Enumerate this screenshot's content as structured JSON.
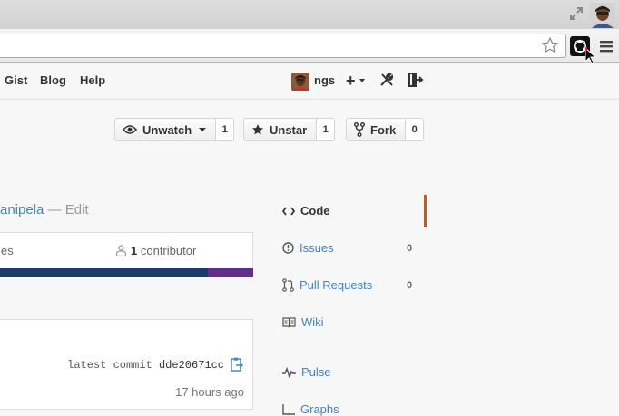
{
  "header": {
    "nav": [
      "Gist",
      "Blog",
      "Help"
    ],
    "username": "ngs",
    "plus_label": "+"
  },
  "repo_actions": {
    "watch": {
      "label": "Unwatch",
      "count": "1"
    },
    "star": {
      "label": "Unstar",
      "count": "1"
    },
    "fork": {
      "label": "Fork",
      "count": "0"
    }
  },
  "title": {
    "name": "anipela",
    "separator": "—",
    "edit": "Edit"
  },
  "stats": {
    "branches_partial": "es",
    "contributors_count": "1",
    "contributors_label": "contributor"
  },
  "language_colors": [
    "#1c3b6b",
    "#5f2f8a"
  ],
  "commit": {
    "label": "latest commit",
    "hash": "dde20671cc",
    "time": "17 hours ago"
  },
  "repo_nav": [
    {
      "label": "Code",
      "icon": "code-icon",
      "selected": true
    },
    {
      "label": "Issues",
      "icon": "issue-icon",
      "count": "0"
    },
    {
      "label": "Pull Requests",
      "icon": "pull-request-icon",
      "count": "0"
    },
    {
      "label": "Wiki",
      "icon": "book-icon"
    },
    {
      "label": "Pulse",
      "icon": "pulse-icon"
    },
    {
      "label": "Graphs",
      "icon": "graph-icon"
    }
  ],
  "colors": {
    "link": "#4183c4",
    "selected_bar": "#c75b1c"
  }
}
